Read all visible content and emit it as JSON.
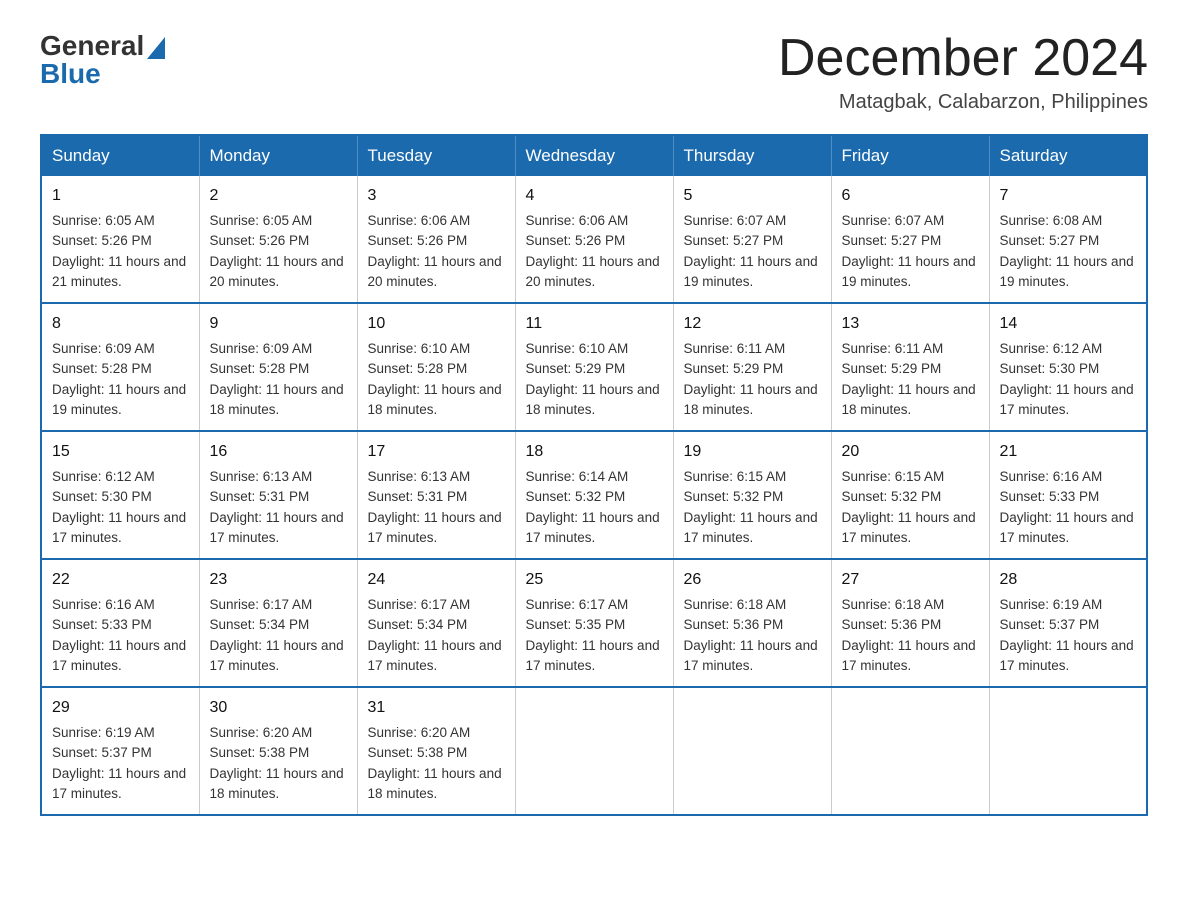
{
  "logo": {
    "general": "General",
    "blue": "Blue"
  },
  "title": {
    "month_year": "December 2024",
    "location": "Matagbak, Calabarzon, Philippines"
  },
  "headers": [
    "Sunday",
    "Monday",
    "Tuesday",
    "Wednesday",
    "Thursday",
    "Friday",
    "Saturday"
  ],
  "weeks": [
    [
      {
        "day": "1",
        "sunrise": "6:05 AM",
        "sunset": "5:26 PM",
        "daylight": "11 hours and 21 minutes."
      },
      {
        "day": "2",
        "sunrise": "6:05 AM",
        "sunset": "5:26 PM",
        "daylight": "11 hours and 20 minutes."
      },
      {
        "day": "3",
        "sunrise": "6:06 AM",
        "sunset": "5:26 PM",
        "daylight": "11 hours and 20 minutes."
      },
      {
        "day": "4",
        "sunrise": "6:06 AM",
        "sunset": "5:26 PM",
        "daylight": "11 hours and 20 minutes."
      },
      {
        "day": "5",
        "sunrise": "6:07 AM",
        "sunset": "5:27 PM",
        "daylight": "11 hours and 19 minutes."
      },
      {
        "day": "6",
        "sunrise": "6:07 AM",
        "sunset": "5:27 PM",
        "daylight": "11 hours and 19 minutes."
      },
      {
        "day": "7",
        "sunrise": "6:08 AM",
        "sunset": "5:27 PM",
        "daylight": "11 hours and 19 minutes."
      }
    ],
    [
      {
        "day": "8",
        "sunrise": "6:09 AM",
        "sunset": "5:28 PM",
        "daylight": "11 hours and 19 minutes."
      },
      {
        "day": "9",
        "sunrise": "6:09 AM",
        "sunset": "5:28 PM",
        "daylight": "11 hours and 18 minutes."
      },
      {
        "day": "10",
        "sunrise": "6:10 AM",
        "sunset": "5:28 PM",
        "daylight": "11 hours and 18 minutes."
      },
      {
        "day": "11",
        "sunrise": "6:10 AM",
        "sunset": "5:29 PM",
        "daylight": "11 hours and 18 minutes."
      },
      {
        "day": "12",
        "sunrise": "6:11 AM",
        "sunset": "5:29 PM",
        "daylight": "11 hours and 18 minutes."
      },
      {
        "day": "13",
        "sunrise": "6:11 AM",
        "sunset": "5:29 PM",
        "daylight": "11 hours and 18 minutes."
      },
      {
        "day": "14",
        "sunrise": "6:12 AM",
        "sunset": "5:30 PM",
        "daylight": "11 hours and 17 minutes."
      }
    ],
    [
      {
        "day": "15",
        "sunrise": "6:12 AM",
        "sunset": "5:30 PM",
        "daylight": "11 hours and 17 minutes."
      },
      {
        "day": "16",
        "sunrise": "6:13 AM",
        "sunset": "5:31 PM",
        "daylight": "11 hours and 17 minutes."
      },
      {
        "day": "17",
        "sunrise": "6:13 AM",
        "sunset": "5:31 PM",
        "daylight": "11 hours and 17 minutes."
      },
      {
        "day": "18",
        "sunrise": "6:14 AM",
        "sunset": "5:32 PM",
        "daylight": "11 hours and 17 minutes."
      },
      {
        "day": "19",
        "sunrise": "6:15 AM",
        "sunset": "5:32 PM",
        "daylight": "11 hours and 17 minutes."
      },
      {
        "day": "20",
        "sunrise": "6:15 AM",
        "sunset": "5:32 PM",
        "daylight": "11 hours and 17 minutes."
      },
      {
        "day": "21",
        "sunrise": "6:16 AM",
        "sunset": "5:33 PM",
        "daylight": "11 hours and 17 minutes."
      }
    ],
    [
      {
        "day": "22",
        "sunrise": "6:16 AM",
        "sunset": "5:33 PM",
        "daylight": "11 hours and 17 minutes."
      },
      {
        "day": "23",
        "sunrise": "6:17 AM",
        "sunset": "5:34 PM",
        "daylight": "11 hours and 17 minutes."
      },
      {
        "day": "24",
        "sunrise": "6:17 AM",
        "sunset": "5:34 PM",
        "daylight": "11 hours and 17 minutes."
      },
      {
        "day": "25",
        "sunrise": "6:17 AM",
        "sunset": "5:35 PM",
        "daylight": "11 hours and 17 minutes."
      },
      {
        "day": "26",
        "sunrise": "6:18 AM",
        "sunset": "5:36 PM",
        "daylight": "11 hours and 17 minutes."
      },
      {
        "day": "27",
        "sunrise": "6:18 AM",
        "sunset": "5:36 PM",
        "daylight": "11 hours and 17 minutes."
      },
      {
        "day": "28",
        "sunrise": "6:19 AM",
        "sunset": "5:37 PM",
        "daylight": "11 hours and 17 minutes."
      }
    ],
    [
      {
        "day": "29",
        "sunrise": "6:19 AM",
        "sunset": "5:37 PM",
        "daylight": "11 hours and 17 minutes."
      },
      {
        "day": "30",
        "sunrise": "6:20 AM",
        "sunset": "5:38 PM",
        "daylight": "11 hours and 18 minutes."
      },
      {
        "day": "31",
        "sunrise": "6:20 AM",
        "sunset": "5:38 PM",
        "daylight": "11 hours and 18 minutes."
      },
      null,
      null,
      null,
      null
    ]
  ],
  "labels": {
    "sunrise": "Sunrise: ",
    "sunset": "Sunset: ",
    "daylight": "Daylight: "
  }
}
